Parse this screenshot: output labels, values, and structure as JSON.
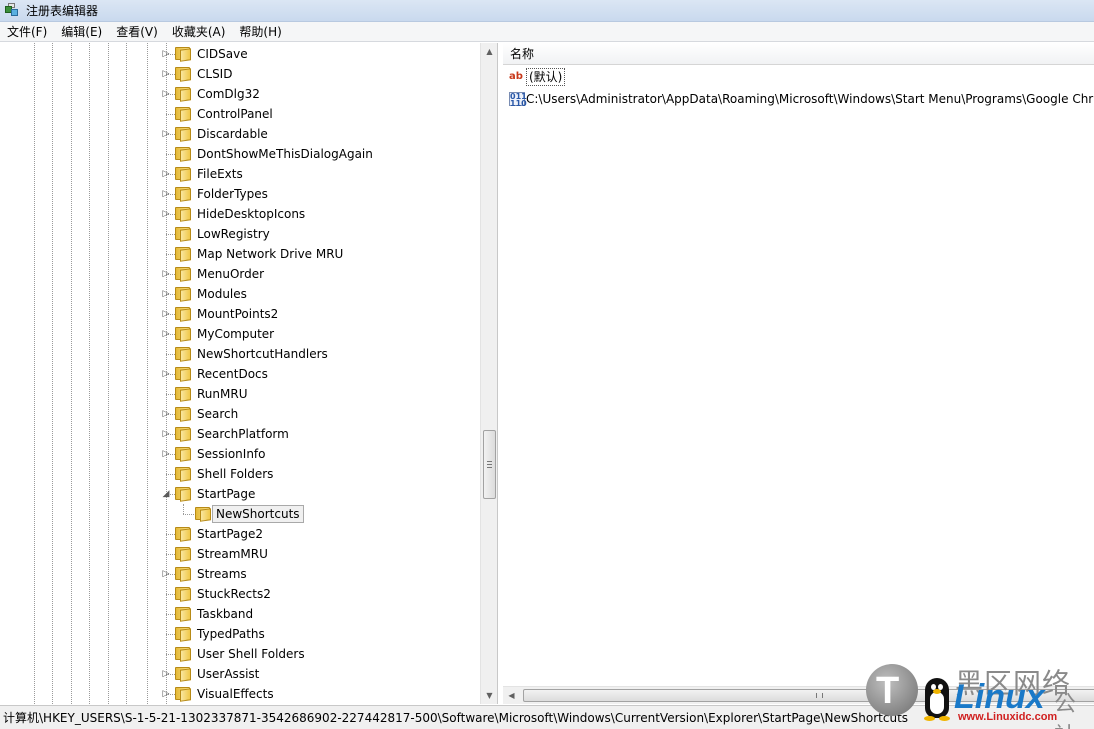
{
  "window": {
    "title": "注册表编辑器",
    "icon": "regedit-icon"
  },
  "menu": [
    "文件(F)",
    "编辑(E)",
    "查看(V)",
    "收藏夹(A)",
    "帮助(H)"
  ],
  "tree": {
    "items": [
      {
        "label": "CIDSave",
        "expandable": true
      },
      {
        "label": "CLSID",
        "expandable": true
      },
      {
        "label": "ComDlg32",
        "expandable": true
      },
      {
        "label": "ControlPanel",
        "expandable": false
      },
      {
        "label": "Discardable",
        "expandable": true
      },
      {
        "label": "DontShowMeThisDialogAgain",
        "expandable": false
      },
      {
        "label": "FileExts",
        "expandable": true
      },
      {
        "label": "FolderTypes",
        "expandable": true
      },
      {
        "label": "HideDesktopIcons",
        "expandable": true
      },
      {
        "label": "LowRegistry",
        "expandable": false
      },
      {
        "label": "Map Network Drive MRU",
        "expandable": false
      },
      {
        "label": "MenuOrder",
        "expandable": true
      },
      {
        "label": "Modules",
        "expandable": true
      },
      {
        "label": "MountPoints2",
        "expandable": true
      },
      {
        "label": "MyComputer",
        "expandable": true
      },
      {
        "label": "NewShortcutHandlers",
        "expandable": false
      },
      {
        "label": "RecentDocs",
        "expandable": true
      },
      {
        "label": "RunMRU",
        "expandable": false
      },
      {
        "label": "Search",
        "expandable": true
      },
      {
        "label": "SearchPlatform",
        "expandable": true
      },
      {
        "label": "SessionInfo",
        "expandable": true
      },
      {
        "label": "Shell Folders",
        "expandable": false
      },
      {
        "label": "StartPage",
        "expandable": true,
        "expanded": true
      },
      {
        "label": "NewShortcuts",
        "child": true,
        "selected": true
      },
      {
        "label": "StartPage2",
        "expandable": false
      },
      {
        "label": "StreamMRU",
        "expandable": false
      },
      {
        "label": "Streams",
        "expandable": true
      },
      {
        "label": "StuckRects2",
        "expandable": false
      },
      {
        "label": "Taskband",
        "expandable": false
      },
      {
        "label": "TypedPaths",
        "expandable": false
      },
      {
        "label": "User Shell Folders",
        "expandable": false
      },
      {
        "label": "UserAssist",
        "expandable": true
      },
      {
        "label": "VisualEffects",
        "expandable": true
      }
    ]
  },
  "values_pane": {
    "column_name": "名称",
    "rows": [
      {
        "icon": "string-value-icon",
        "glyph": "ab",
        "name": "(默认)"
      },
      {
        "icon": "binary-value-icon",
        "glyph": "011\n110",
        "name": "C:\\Users\\Administrator\\AppData\\Roaming\\Microsoft\\Windows\\Start Menu\\Programs\\Google Chr"
      }
    ]
  },
  "statusbar": {
    "path": "计算机\\HKEY_USERS\\S-1-5-21-1302337871-3542686902-227442817-500\\Software\\Microsoft\\Windows\\CurrentVersion\\Explorer\\StartPage\\NewShortcuts"
  },
  "watermark": {
    "logo_letter": "T",
    "cn_text": "黑区网络",
    "brand": "Linux",
    "cn_suffix": "公社",
    "url": "www.Linuxidc.com"
  }
}
